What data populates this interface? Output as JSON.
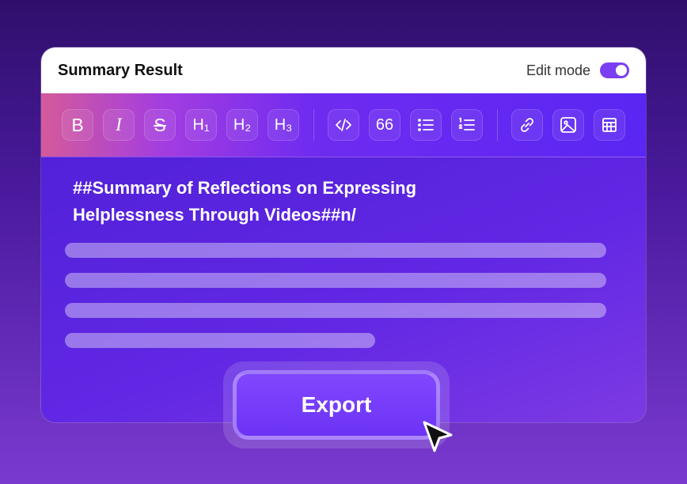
{
  "card": {
    "title": "Summary Result",
    "edit_mode_label": "Edit mode",
    "edit_mode_on": true
  },
  "toolbar": {
    "buttons": [
      {
        "name": "bold",
        "glyph": "B"
      },
      {
        "name": "italic",
        "glyph": "I"
      },
      {
        "name": "strikethrough",
        "glyph": "S"
      },
      {
        "name": "heading-1",
        "glyph": "H₁"
      },
      {
        "name": "heading-2",
        "glyph": "H₂"
      },
      {
        "name": "heading-3",
        "glyph": "H₃"
      },
      {
        "name": "code",
        "icon": "code-icon"
      },
      {
        "name": "quote",
        "glyph": "66"
      },
      {
        "name": "bullet-list",
        "icon": "bullet-list-icon"
      },
      {
        "name": "numbered-list",
        "icon": "numbered-list-icon"
      },
      {
        "name": "link",
        "icon": "link-icon"
      },
      {
        "name": "image",
        "icon": "image-icon"
      },
      {
        "name": "table",
        "icon": "table-icon"
      }
    ]
  },
  "editor": {
    "heading_text": "##Summary of Reflections on Expressing Helplessness Through Videos##n/"
  },
  "export_label": "Export",
  "colors": {
    "accent": "#7a3ff0",
    "background_top": "#2f0f6b",
    "background_bottom": "#7a3ad0"
  }
}
